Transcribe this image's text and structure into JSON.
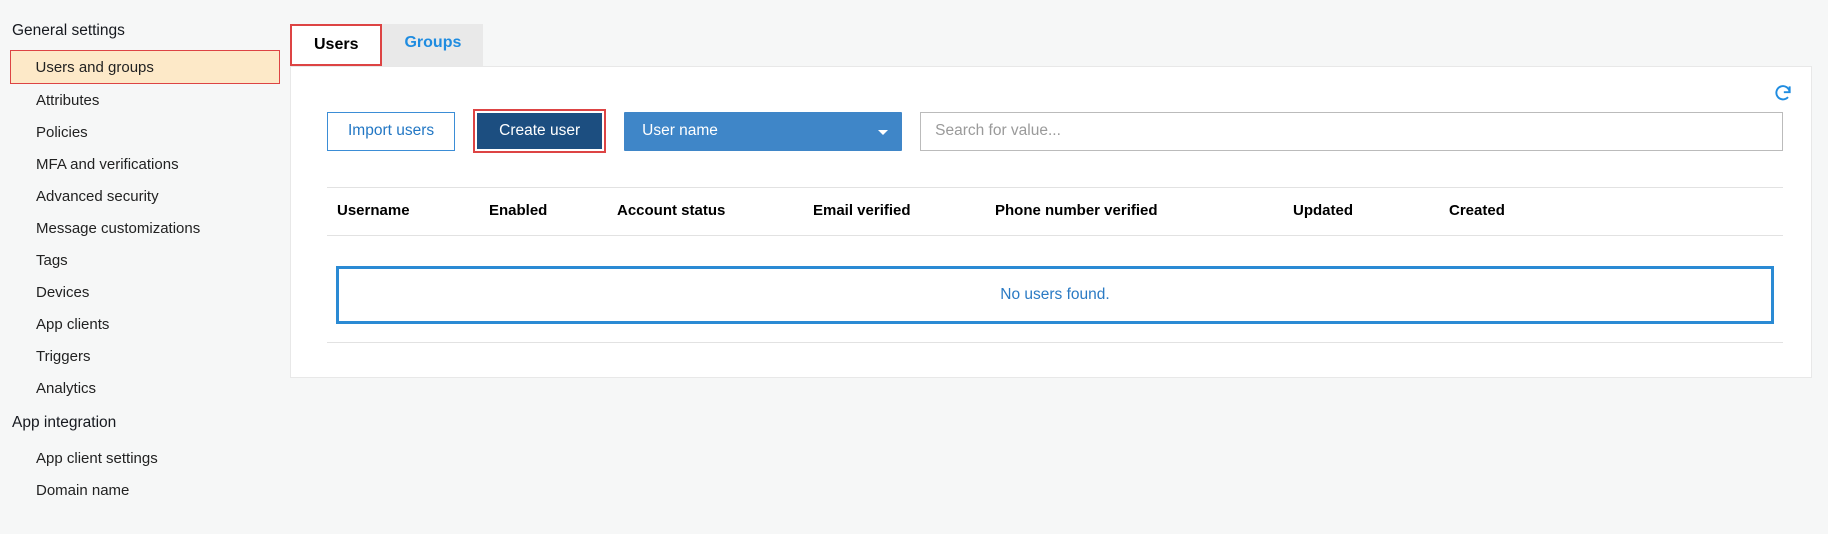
{
  "sidebar": {
    "sections": [
      {
        "header": "General settings",
        "items": [
          {
            "label": "Users and groups",
            "selected": true
          },
          {
            "label": "Attributes"
          },
          {
            "label": "Policies"
          },
          {
            "label": "MFA and verifications"
          },
          {
            "label": "Advanced security"
          },
          {
            "label": "Message customizations"
          },
          {
            "label": "Tags"
          },
          {
            "label": "Devices"
          },
          {
            "label": "App clients"
          },
          {
            "label": "Triggers"
          },
          {
            "label": "Analytics"
          }
        ]
      },
      {
        "header": "App integration",
        "items": [
          {
            "label": "App client settings"
          },
          {
            "label": "Domain name"
          }
        ]
      }
    ]
  },
  "tabs": {
    "users_label": "Users",
    "groups_label": "Groups",
    "active": "users"
  },
  "toolbar": {
    "import_label": "Import users",
    "create_label": "Create user",
    "filter_selected": "User name",
    "search_placeholder": "Search for value..."
  },
  "table": {
    "columns": {
      "username": "Username",
      "enabled": "Enabled",
      "account_status": "Account status",
      "email_verified": "Email verified",
      "phone_verified": "Phone number verified",
      "updated": "Updated",
      "created": "Created"
    },
    "rows": [],
    "empty_message": "No users found."
  }
}
